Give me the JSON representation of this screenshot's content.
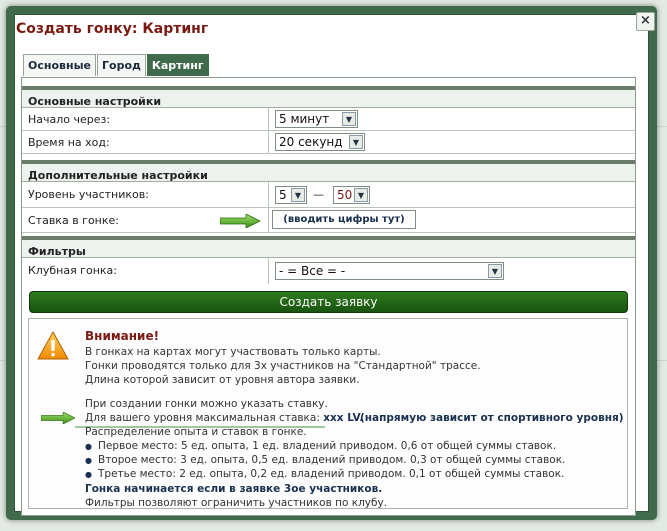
{
  "dialog": {
    "title": "Создать гонку: Картинг",
    "close_label": "×"
  },
  "tabs": [
    {
      "label": "Основные",
      "active": false
    },
    {
      "label": "Город",
      "active": false
    },
    {
      "label": "Картинг",
      "active": true
    }
  ],
  "basic": {
    "heading": "Основные настройки",
    "start_label": "Начало через:",
    "start_value": "5 минут",
    "move_label": "Время на ход:",
    "move_value": "20 секунд"
  },
  "extra": {
    "heading": "Дополнительные настройки",
    "level_label": "Уровень участников:",
    "level_from": "5",
    "level_dash": "—",
    "level_to": "50",
    "stake_label": "Ставка в гонке:",
    "stake_value": "(вводить цифры тут)"
  },
  "filters": {
    "heading": "Фильтры",
    "club_label": "Клубная гонка:",
    "club_value": "- = Все = -"
  },
  "submit_label": "Создать заявку",
  "notice": {
    "title": "Внимание!",
    "lines": [
      "В гонках на картах могут участвовать только карты.",
      "Гонки проводятся только для 3х участников на \"Стандартной\" трассе.",
      "Длина которой зависит от уровня автора заявки.",
      "При создании гонки можно указать ставку.",
      "Для вашего уровня максимальная ставка:",
      "xxx LV.",
      "(напрямую зависит от спортивного уровня)",
      "Распределение опыта и ставок в гонке."
    ],
    "bullets": [
      "Первое место: 5 ед. опыта, 1 ед. владений приводом. 0,6 от общей суммы ставок.",
      "Второе место: 3 ед. опыта, 0,5 ед. владений приводом. 0,3 от общей суммы ставок.",
      "Третье место: 2 ед. опыта, 0,2 ед. владений приводом. 0,1 от общей суммы ставок."
    ],
    "footer_bold": "Гонка начинается если в заявке 3ое участников.",
    "footer": "Фильтры позволяют ограничить участников по клубу."
  },
  "colors": {
    "title": "#7a1a12",
    "tab_active": "#3f6a4c",
    "button": "#1a5410"
  },
  "icons": [
    "close-icon",
    "dropdown-arrow-icon",
    "green-arrow-icon",
    "warning-icon"
  ]
}
